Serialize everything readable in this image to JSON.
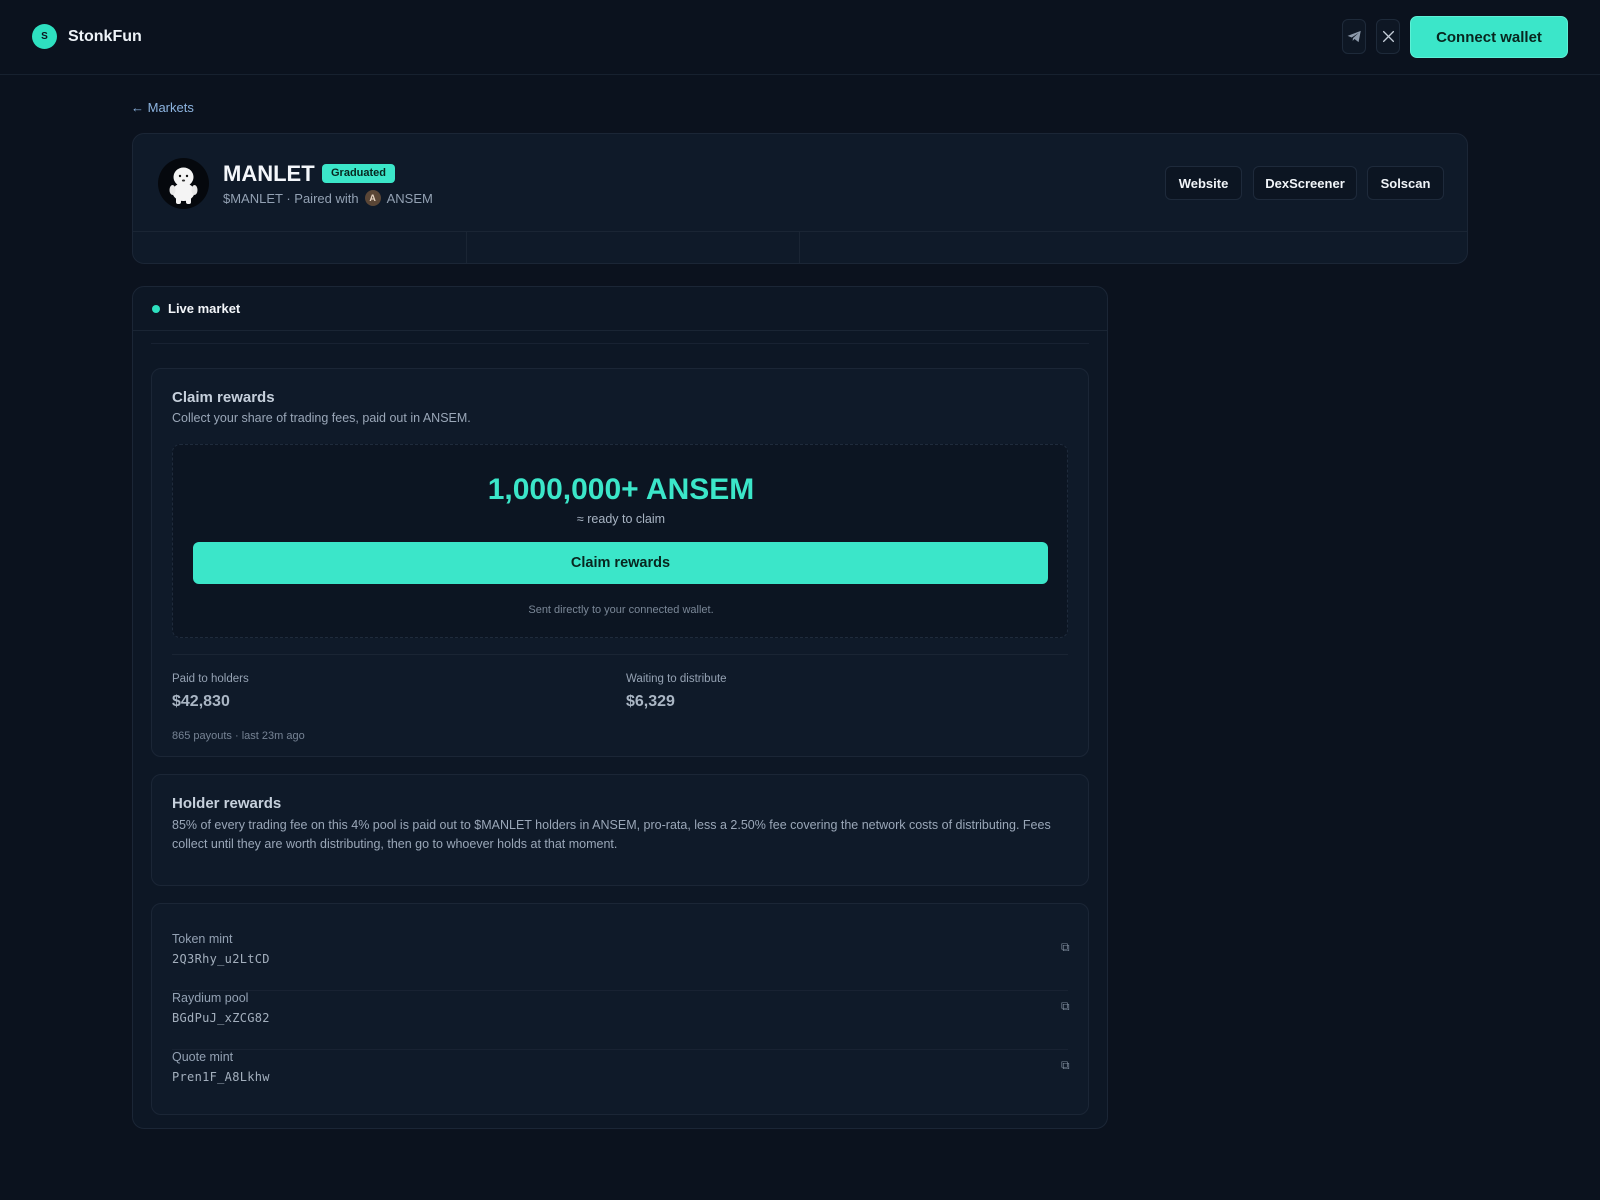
{
  "app": {
    "brand_initial": "S",
    "brand_name": "StonkFun",
    "connect_label": "Connect wallet",
    "accent_color": "#3be6c9"
  },
  "social": {
    "telegram_icon": "telegram-icon",
    "x_icon": "x-icon",
    "x_glyph": "𝕏"
  },
  "nav": {
    "back_label": "← Markets"
  },
  "token": {
    "name": "MANLET",
    "status_badge": "Graduated",
    "ticker_text": "$MANLET · Paired with",
    "quote_initial": "A",
    "quote_symbol": "ANSEM",
    "links": [
      "Website",
      "DexScreener",
      "Solscan"
    ]
  },
  "market": {
    "live_label": "Live market"
  },
  "claim": {
    "title": "Claim rewards",
    "description": "Collect your share of trading fees, paid out in ANSEM.",
    "amount": "1,000,000+ ANSEM",
    "ready_text": "≈ ready to claim",
    "button_label": "Claim rewards",
    "note": "Sent directly to your connected wallet.",
    "paid_label": "Paid to holders",
    "paid_value": "$42,830",
    "waiting_label": "Waiting to distribute",
    "waiting_value": "$6,329",
    "payouts_note": "865 payouts · last 23m ago"
  },
  "holder": {
    "title": "Holder rewards",
    "text": "85% of every trading fee on this 4% pool is paid out to $MANLET holders in ANSEM, pro-rata, less a 2.50% fee covering the network costs of distributing. Fees collect until they are worth distributing, then go to whoever holds at that moment."
  },
  "addresses": [
    {
      "label": "Token mint",
      "value": "2Q3Rhy_u2LtCD"
    },
    {
      "label": "Raydium pool",
      "value": "BGdPuJ_xZCG82"
    },
    {
      "label": "Quote mint",
      "value": "Pren1F_A8Lkhw"
    }
  ],
  "icons": {
    "copy_glyph": "⧉"
  }
}
